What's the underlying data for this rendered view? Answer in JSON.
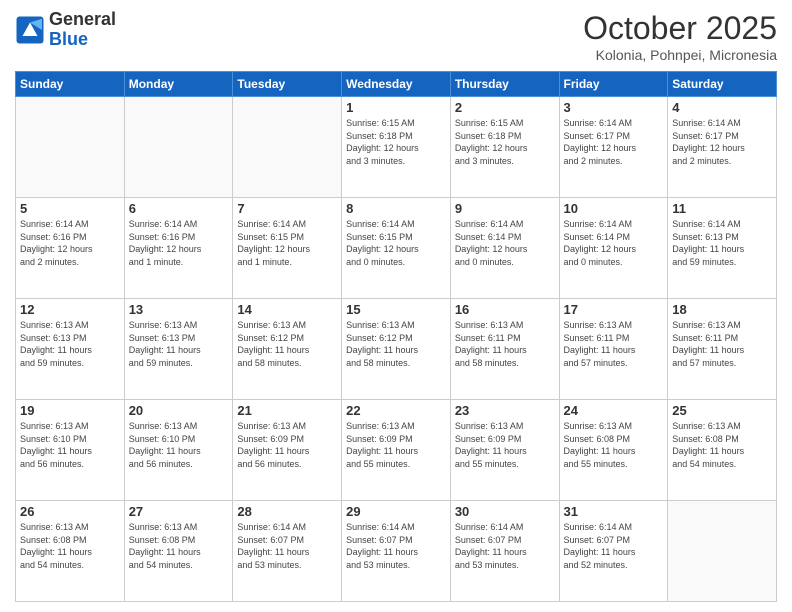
{
  "header": {
    "logo_general": "General",
    "logo_blue": "Blue",
    "month": "October 2025",
    "location": "Kolonia, Pohnpei, Micronesia"
  },
  "days_of_week": [
    "Sunday",
    "Monday",
    "Tuesday",
    "Wednesday",
    "Thursday",
    "Friday",
    "Saturday"
  ],
  "weeks": [
    [
      {
        "day": "",
        "info": ""
      },
      {
        "day": "",
        "info": ""
      },
      {
        "day": "",
        "info": ""
      },
      {
        "day": "1",
        "info": "Sunrise: 6:15 AM\nSunset: 6:18 PM\nDaylight: 12 hours\nand 3 minutes."
      },
      {
        "day": "2",
        "info": "Sunrise: 6:15 AM\nSunset: 6:18 PM\nDaylight: 12 hours\nand 3 minutes."
      },
      {
        "day": "3",
        "info": "Sunrise: 6:14 AM\nSunset: 6:17 PM\nDaylight: 12 hours\nand 2 minutes."
      },
      {
        "day": "4",
        "info": "Sunrise: 6:14 AM\nSunset: 6:17 PM\nDaylight: 12 hours\nand 2 minutes."
      }
    ],
    [
      {
        "day": "5",
        "info": "Sunrise: 6:14 AM\nSunset: 6:16 PM\nDaylight: 12 hours\nand 2 minutes."
      },
      {
        "day": "6",
        "info": "Sunrise: 6:14 AM\nSunset: 6:16 PM\nDaylight: 12 hours\nand 1 minute."
      },
      {
        "day": "7",
        "info": "Sunrise: 6:14 AM\nSunset: 6:15 PM\nDaylight: 12 hours\nand 1 minute."
      },
      {
        "day": "8",
        "info": "Sunrise: 6:14 AM\nSunset: 6:15 PM\nDaylight: 12 hours\nand 0 minutes."
      },
      {
        "day": "9",
        "info": "Sunrise: 6:14 AM\nSunset: 6:14 PM\nDaylight: 12 hours\nand 0 minutes."
      },
      {
        "day": "10",
        "info": "Sunrise: 6:14 AM\nSunset: 6:14 PM\nDaylight: 12 hours\nand 0 minutes."
      },
      {
        "day": "11",
        "info": "Sunrise: 6:14 AM\nSunset: 6:13 PM\nDaylight: 11 hours\nand 59 minutes."
      }
    ],
    [
      {
        "day": "12",
        "info": "Sunrise: 6:13 AM\nSunset: 6:13 PM\nDaylight: 11 hours\nand 59 minutes."
      },
      {
        "day": "13",
        "info": "Sunrise: 6:13 AM\nSunset: 6:13 PM\nDaylight: 11 hours\nand 59 minutes."
      },
      {
        "day": "14",
        "info": "Sunrise: 6:13 AM\nSunset: 6:12 PM\nDaylight: 11 hours\nand 58 minutes."
      },
      {
        "day": "15",
        "info": "Sunrise: 6:13 AM\nSunset: 6:12 PM\nDaylight: 11 hours\nand 58 minutes."
      },
      {
        "day": "16",
        "info": "Sunrise: 6:13 AM\nSunset: 6:11 PM\nDaylight: 11 hours\nand 58 minutes."
      },
      {
        "day": "17",
        "info": "Sunrise: 6:13 AM\nSunset: 6:11 PM\nDaylight: 11 hours\nand 57 minutes."
      },
      {
        "day": "18",
        "info": "Sunrise: 6:13 AM\nSunset: 6:11 PM\nDaylight: 11 hours\nand 57 minutes."
      }
    ],
    [
      {
        "day": "19",
        "info": "Sunrise: 6:13 AM\nSunset: 6:10 PM\nDaylight: 11 hours\nand 56 minutes."
      },
      {
        "day": "20",
        "info": "Sunrise: 6:13 AM\nSunset: 6:10 PM\nDaylight: 11 hours\nand 56 minutes."
      },
      {
        "day": "21",
        "info": "Sunrise: 6:13 AM\nSunset: 6:09 PM\nDaylight: 11 hours\nand 56 minutes."
      },
      {
        "day": "22",
        "info": "Sunrise: 6:13 AM\nSunset: 6:09 PM\nDaylight: 11 hours\nand 55 minutes."
      },
      {
        "day": "23",
        "info": "Sunrise: 6:13 AM\nSunset: 6:09 PM\nDaylight: 11 hours\nand 55 minutes."
      },
      {
        "day": "24",
        "info": "Sunrise: 6:13 AM\nSunset: 6:08 PM\nDaylight: 11 hours\nand 55 minutes."
      },
      {
        "day": "25",
        "info": "Sunrise: 6:13 AM\nSunset: 6:08 PM\nDaylight: 11 hours\nand 54 minutes."
      }
    ],
    [
      {
        "day": "26",
        "info": "Sunrise: 6:13 AM\nSunset: 6:08 PM\nDaylight: 11 hours\nand 54 minutes."
      },
      {
        "day": "27",
        "info": "Sunrise: 6:13 AM\nSunset: 6:08 PM\nDaylight: 11 hours\nand 54 minutes."
      },
      {
        "day": "28",
        "info": "Sunrise: 6:14 AM\nSunset: 6:07 PM\nDaylight: 11 hours\nand 53 minutes."
      },
      {
        "day": "29",
        "info": "Sunrise: 6:14 AM\nSunset: 6:07 PM\nDaylight: 11 hours\nand 53 minutes."
      },
      {
        "day": "30",
        "info": "Sunrise: 6:14 AM\nSunset: 6:07 PM\nDaylight: 11 hours\nand 53 minutes."
      },
      {
        "day": "31",
        "info": "Sunrise: 6:14 AM\nSunset: 6:07 PM\nDaylight: 11 hours\nand 52 minutes."
      },
      {
        "day": "",
        "info": ""
      }
    ]
  ]
}
